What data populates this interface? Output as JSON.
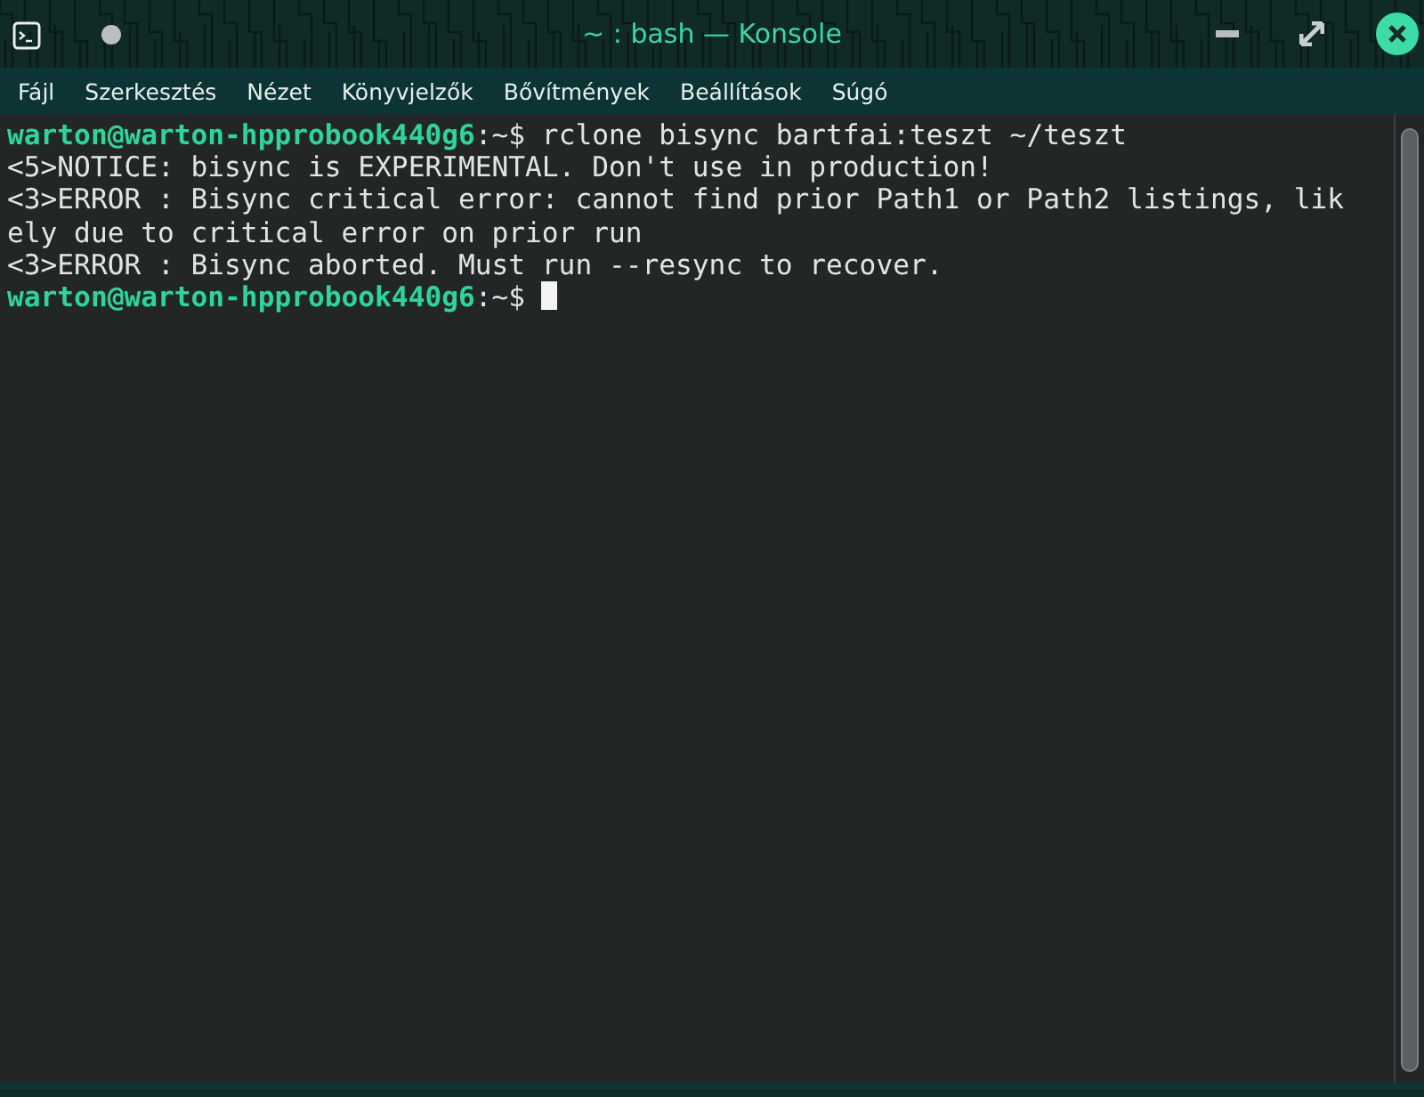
{
  "window": {
    "title": "~ : bash — Konsole"
  },
  "menu": [
    "Fájl",
    "Szerkesztés",
    "Nézet",
    "Könyvjelzők",
    "Bővítmények",
    "Beállítások",
    "Súgó"
  ],
  "terminal": {
    "lines": [
      {
        "kind": "prompt",
        "user": "warton@warton-hpprobook440g6",
        "path": ":~$",
        "command": " rclone bisync bartfai:teszt ~/teszt",
        "cursor": false
      },
      {
        "kind": "output",
        "text": "<5>NOTICE: bisync is EXPERIMENTAL. Don't use in production!"
      },
      {
        "kind": "output",
        "text": "<3>ERROR : Bisync critical error: cannot find prior Path1 or Path2 listings, lik"
      },
      {
        "kind": "output",
        "text": "ely due to critical error on prior run"
      },
      {
        "kind": "output",
        "text": "<3>ERROR : Bisync aborted. Must run --resync to recover."
      },
      {
        "kind": "prompt",
        "user": "warton@warton-hpprobook440g6",
        "path": ":~$",
        "cursor": true
      }
    ]
  }
}
